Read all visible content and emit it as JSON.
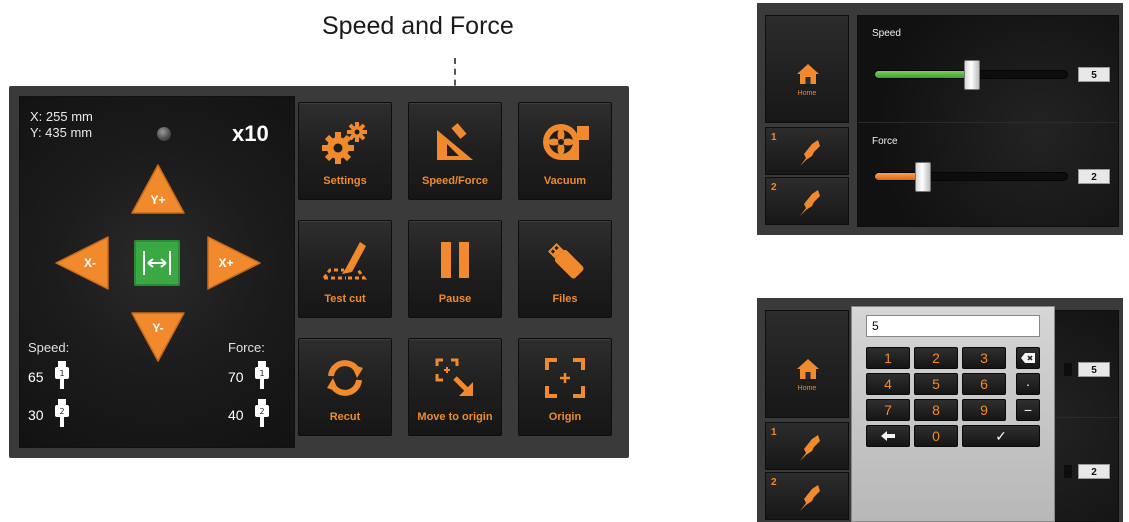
{
  "callout": {
    "title": "Speed and Force"
  },
  "main": {
    "coords": {
      "x": "X: 255 mm",
      "y": "Y: 435 mm"
    },
    "multiplier": "x10",
    "jog": {
      "up": "Y+",
      "down": "Y-",
      "left": "X-",
      "right": "X+"
    },
    "speed": {
      "label": "Speed:",
      "tool1": "65",
      "tool2": "30"
    },
    "force": {
      "label": "Force:",
      "tool1": "70",
      "tool2": "40"
    },
    "tiles": [
      {
        "label": "Settings",
        "icon": "gears-icon"
      },
      {
        "label": "Speed/Force",
        "icon": "speed-force-icon"
      },
      {
        "label": "Vacuum",
        "icon": "vacuum-fan-icon"
      },
      {
        "label": "Test cut",
        "icon": "test-cut-icon"
      },
      {
        "label": "Pause",
        "icon": "pause-icon"
      },
      {
        "label": "Files",
        "icon": "usb-drive-icon"
      },
      {
        "label": "Recut",
        "icon": "recut-icon"
      },
      {
        "label": "Move to origin",
        "icon": "move-to-origin-icon"
      },
      {
        "label": "Origin",
        "icon": "origin-icon"
      }
    ]
  },
  "speed_force_panel": {
    "home_label": "Home",
    "tool1_num": "1",
    "tool2_num": "2",
    "speed": {
      "label": "Speed",
      "value": "5",
      "level": 0.5
    },
    "force": {
      "label": "Force",
      "value": "2",
      "level": 0.25
    }
  },
  "keypad_panel": {
    "home_label": "Home",
    "tool1_num": "1",
    "tool2_num": "2",
    "input_value": "5",
    "speed_value": "5",
    "force_value": "2",
    "keys": {
      "k1": "1",
      "k2": "2",
      "k3": "3",
      "k4": "4",
      "k5": "5",
      "k6": "6",
      "k7": "7",
      "k8": "8",
      "k9": "9",
      "k0": "0",
      "dot": "·",
      "minus": "−",
      "ok": "✓",
      "back": "⌫",
      "ret": "←"
    }
  },
  "colors": {
    "accent": "#f08a2c",
    "green": "#3ba943",
    "panel": "#3a3a3a"
  }
}
